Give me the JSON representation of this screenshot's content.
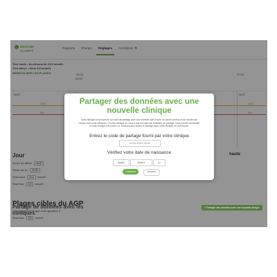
{
  "app": {
    "logo_line1": "DEXCOM",
    "logo_line2": "CLARITY",
    "nav": [
      {
        "label": "Rapports"
      },
      {
        "label": "Charger"
      },
      {
        "label": "Réglages"
      },
      {
        "label": "Assistance"
      }
    ],
    "active_nav_index": 2,
    "assistance_caret": "▼"
  },
  "settings": {
    "line1": "Très haute : Au-dessus de 13,9 mmol/L",
    "line2": "Très basse : Sous 3,0 mmol/L",
    "reset_link": "RÉINITIALISER LES PLAGES",
    "times": [
      "00:00",
      "06:00",
      "22:00"
    ],
    "band_labels": [
      "NUIT",
      "JOUR",
      "NUIT"
    ],
    "high_value": "10,0",
    "low_value": "3,9",
    "day_title": "Jour",
    "right_title": "haute",
    "day_start_label": "Heure de début",
    "day_start_value": "06:00",
    "day_end_label": "Heure de fin",
    "day_end_value": "22:00",
    "high_threshold_label": "Seuil haut",
    "high_threshold_value": "10,0",
    "low_threshold_label": "Seuil bas",
    "low_threshold_value": "3,9",
    "unit": "mmol/L",
    "agp_title": "Plages cibles du AGP",
    "agp_desc": "Les changements que vous apportez à",
    "agp_low_label": "Seuil bas",
    "agp_low_value": "3,9",
    "share_title_1": "Partage de données avec les",
    "share_title_2": "cliniques",
    "share_button": "+ Partager des données avec une nouvelle clinique"
  },
  "modal": {
    "title": "Partager des données avec une nouvelle clinique",
    "description": "Votre clinique vous fournira un code de partage pour vos données afin d'avoir un accès continu et de rendre vos rendez-vous plus efficaces. Si votre clinique ne vous a pas envoyé une invitation au partage, vous pouvez demander à votre clinique d'en créer un. Vous pouvez cesser le partage avec votre clinique en tout temps.",
    "code_prompt": "Entrez le code de partage fourni par votre clinique",
    "code_placeholder": "XXXX-XXXX-XXXX",
    "dob_prompt": "Vérifiez votre date de naissance",
    "year_placeholder": "AAAA",
    "month_value": "Mois",
    "day_placeholder": "JJ",
    "continue_label": "Continuer",
    "cancel_label": "Annuler"
  },
  "colors": {
    "accent": "#6ab04c",
    "high_line": "#e8a33d",
    "low_line": "#d9534f",
    "overlay": "rgba(0,0,0,0.42)"
  }
}
